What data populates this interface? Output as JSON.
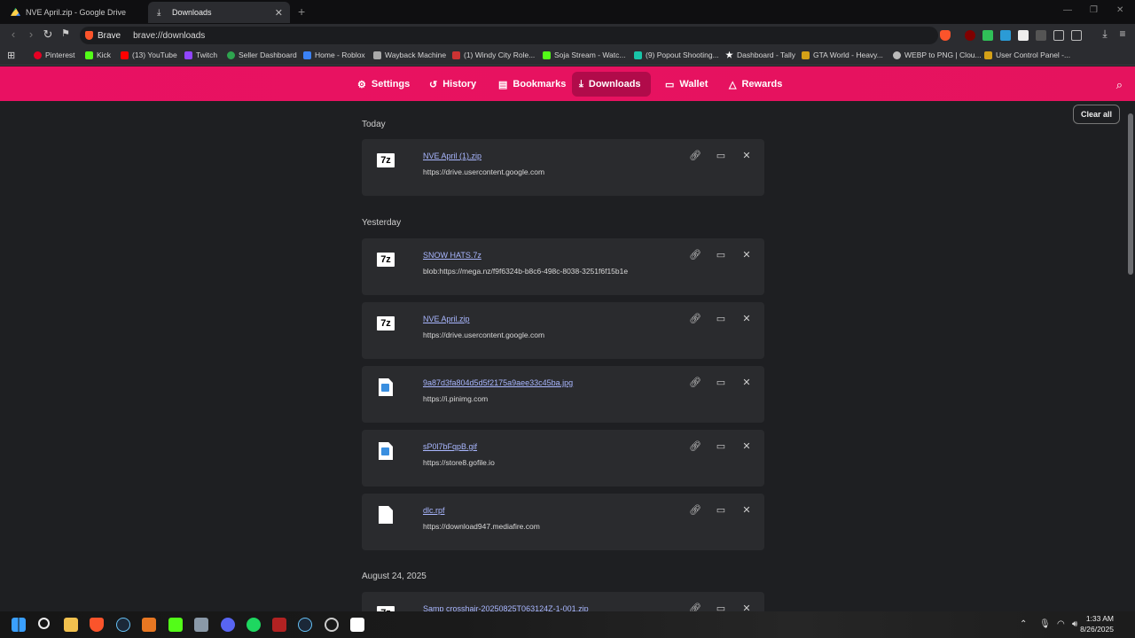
{
  "tabs": [
    {
      "title": "NVE April.zip - Google Drive",
      "active": false
    },
    {
      "title": "Downloads",
      "active": true
    }
  ],
  "toolbar": {
    "brave_label": "Brave",
    "url": "brave://downloads"
  },
  "bookmarks": [
    {
      "label": "Pinterest",
      "color": "#e60023"
    },
    {
      "label": "Kick",
      "color": "#53fc18"
    },
    {
      "label": "(13) YouTube",
      "color": "#ff0000"
    },
    {
      "label": "Twitch",
      "color": "#9146ff"
    },
    {
      "label": "Seller Dashboard",
      "color": "#2ea44f"
    },
    {
      "label": "Home - Roblox",
      "color": "#3b82f6"
    },
    {
      "label": "Wayback Machine",
      "color": "#aaaaaa"
    },
    {
      "label": "(1) Windy City Role...",
      "color": "#cc3333"
    },
    {
      "label": "Soja Stream - Watc...",
      "color": "#53fc18"
    },
    {
      "label": "(9) Popout Shooting...",
      "color": "#18c5a8"
    },
    {
      "label": "Dashboard - Tally",
      "color": "#ffffff"
    },
    {
      "label": "GTA World - Heavy...",
      "color": "#d4a017"
    },
    {
      "label": "WEBP to PNG | Clou...",
      "color": "#bbbbbb"
    },
    {
      "label": "User Control Panel -...",
      "color": "#d4a017"
    }
  ],
  "nav": {
    "settings": "Settings",
    "history": "History",
    "bookmarks": "Bookmarks",
    "downloads": "Downloads",
    "wallet": "Wallet",
    "rewards": "Rewards"
  },
  "clear_all": "Clear all",
  "groups": [
    {
      "label": "Today"
    },
    {
      "label": "Yesterday"
    },
    {
      "label": "August 24, 2025"
    }
  ],
  "downloads": [
    {
      "name": "NVE April (1).zip",
      "source": "https://drive.usercontent.google.com",
      "icon": "7z-icon"
    },
    {
      "name": "SNOW HATS.7z",
      "source": "blob:https://mega.nz/f9f6324b-b8c6-498c-8038-3251f6f15b1e",
      "icon": "7z-icon"
    },
    {
      "name": "NVE April.zip",
      "source": "https://drive.usercontent.google.com",
      "icon": "7z-icon"
    },
    {
      "name": "9a87d3fa804d5d5f2175a9aee33c45ba.jpg",
      "source": "https://i.pinimg.com",
      "icon": "image-file-icon"
    },
    {
      "name": "sP0l7bFqpB.gif",
      "source": "https://store8.gofile.io",
      "icon": "image-file-icon"
    },
    {
      "name": "dlc.rpf",
      "source": "https://download947.mediafire.com",
      "icon": "generic-file-icon"
    },
    {
      "name": "Samp crosshair-20250825T063124Z-1-001.zip",
      "source": "",
      "icon": "7z-icon"
    }
  ],
  "taskbar": {
    "time": "1:33 AM",
    "date": "8/26/2025"
  },
  "colors": {
    "accent": "#e91162",
    "active_nav": "#b10b4a",
    "link": "#a9b7ff",
    "card_bg": "#2a2b2e"
  }
}
